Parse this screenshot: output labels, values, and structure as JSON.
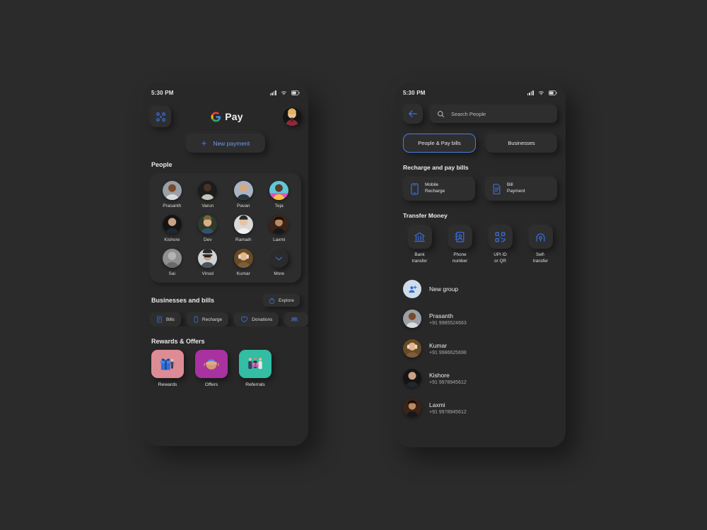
{
  "theme": {
    "background": "#2b2b2b",
    "surface": "#2e2e2e",
    "accent": "#4285f4",
    "text": "#eaeaea",
    "muted": "#a9a9a9"
  },
  "left_phone": {
    "status_bar": {
      "time": "5:30 PM",
      "signal_icon": "cellular-signal-icon",
      "wifi_icon": "wifi-icon",
      "battery_icon": "battery-icon"
    },
    "app_bar": {
      "scan_icon": "qr-scan-icon",
      "brand_logo": "google-g-logo",
      "brand_text": "Pay",
      "avatar": "profile-avatar"
    },
    "new_payment": {
      "label": "New payment",
      "plus": "+"
    },
    "people": {
      "heading": "People",
      "contacts": [
        {
          "name": "Prasanth"
        },
        {
          "name": "Varun"
        },
        {
          "name": "Pavan"
        },
        {
          "name": "Teja"
        },
        {
          "name": "Kishore"
        },
        {
          "name": "Dev"
        },
        {
          "name": "Ramaih"
        },
        {
          "name": "Laxmi"
        },
        {
          "name": "Sai"
        },
        {
          "name": "Vinod"
        },
        {
          "name": "Kumar"
        }
      ],
      "more": {
        "label": "More",
        "icon": "chevron-down-icon"
      }
    },
    "businesses": {
      "heading": "Businesses and bills",
      "explore": {
        "label": "Explore",
        "icon": "shopping-bag-icon"
      },
      "chips": [
        {
          "label": "Bills",
          "icon": "receipt-icon"
        },
        {
          "label": "Recharge",
          "icon": "mobile-icon"
        },
        {
          "label": "Donations",
          "icon": "heart-hand-icon"
        },
        {
          "label": "",
          "icon": "insurance-icon"
        }
      ]
    },
    "rewards": {
      "heading": "Rewards & Offers",
      "items": [
        {
          "label": "Rewards",
          "color": "#dd8c95",
          "glyph": "🎁"
        },
        {
          "label": "Offers",
          "color": "#a832a0",
          "glyph": "🫕"
        },
        {
          "label": "Referrals",
          "color": "#32bda4",
          "glyph": "🎊"
        }
      ]
    }
  },
  "right_phone": {
    "status_bar": {
      "time": "5:30 PM",
      "signal_icon": "cellular-signal-icon",
      "wifi_icon": "wifi-icon",
      "battery_icon": "battery-icon"
    },
    "search": {
      "back_icon": "back-arrow-icon",
      "search_icon": "search-icon",
      "placeholder": "Search People",
      "value": ""
    },
    "tabs": [
      {
        "label": "People & Pay bills",
        "active": true
      },
      {
        "label": "Businesses",
        "active": false
      }
    ],
    "recharge_section": {
      "heading": "Recharge and pay bills",
      "cards": [
        {
          "label_line1": "Mobile",
          "label_line2": "Recharge",
          "icon": "mobile-phone-icon"
        },
        {
          "label_line1": "Bill",
          "label_line2": "Payment",
          "icon": "bill-document-icon"
        }
      ]
    },
    "transfer_section": {
      "heading": "Transfer Money",
      "items": [
        {
          "line1": "Bank",
          "line2": "transfer",
          "icon": "bank-icon"
        },
        {
          "line1": "Phone",
          "line2": "number",
          "icon": "contact-book-icon"
        },
        {
          "line1": "UPI ID",
          "line2": "or QR",
          "icon": "qr-code-icon"
        },
        {
          "line1": "Self-",
          "line2": "transfer",
          "icon": "self-transfer-icon"
        }
      ]
    },
    "contacts": {
      "new_group": {
        "label": "New group",
        "icon": "add-person-icon"
      },
      "list": [
        {
          "name": "Prasanth",
          "phone": "+91 9985524663"
        },
        {
          "name": "Kumar",
          "phone": "+91 9986625698"
        },
        {
          "name": "Kishore",
          "phone": "+91 9978945612"
        },
        {
          "name": "Laxmi",
          "phone": "+91 9978945612"
        }
      ]
    }
  }
}
